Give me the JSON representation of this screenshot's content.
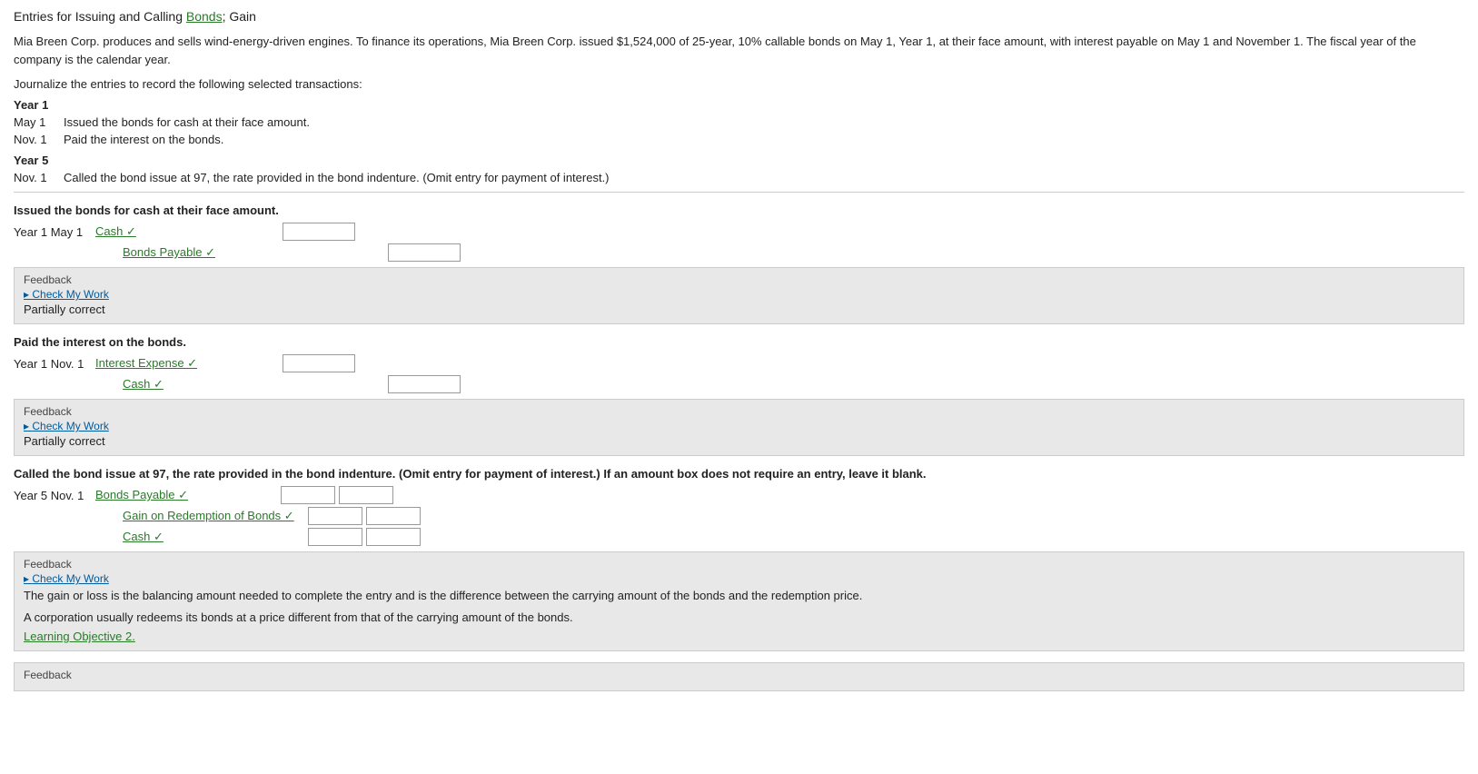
{
  "title": {
    "prefix": "Entries for Issuing and Calling ",
    "link1": "Bonds",
    "middle": "; Gain",
    "description": "Mia Breen Corp. produces and sells wind-energy-driven engines. To finance its operations, Mia Breen Corp. issued $1,524,000 of 25-year, 10% callable bonds on May 1, Year 1, at their face amount, with interest payable on May 1 and November 1. The fiscal year of the company is the calendar year."
  },
  "instruction": "Journalize the entries to record the following selected transactions:",
  "year1_label": "Year 1",
  "year5_label": "Year 5",
  "transactions": [
    {
      "date": "May 1",
      "text": "Issued the bonds for cash at their face amount."
    },
    {
      "date": "Nov. 1",
      "text": "Paid the interest on the bonds."
    },
    {
      "date": "Nov. 1",
      "text": "Called the bond issue at 97, the rate provided in the bond indenture. (Omit entry for payment of interest.)"
    }
  ],
  "section1": {
    "label": "Issued the bonds for cash at their face amount.",
    "date": "Year 1 May 1",
    "entries": [
      {
        "account": "Cash ✓",
        "indent": false
      },
      {
        "account": "Bonds Payable ✓",
        "indent": true
      }
    ]
  },
  "section2": {
    "label": "Paid the interest on the bonds.",
    "date": "Year 1 Nov. 1",
    "entries": [
      {
        "account": "Interest Expense ✓",
        "indent": false
      },
      {
        "account": "Cash ✓",
        "indent": true
      }
    ]
  },
  "section3": {
    "label": "Called the bond issue at 97, the rate provided in the bond indenture. (Omit entry for payment of interest.) If an amount box does not require an entry, leave it blank.",
    "date": "Year 5 Nov. 1",
    "entries": [
      {
        "account": "Bonds Payable ✓",
        "indent": false
      },
      {
        "account": "Gain on Redemption of Bonds ✓",
        "indent": true
      },
      {
        "account": "Cash ✓",
        "indent": true
      }
    ]
  },
  "feedback": {
    "label": "Feedback",
    "check_my_work": "Check My Work",
    "partially_correct": "Partially correct",
    "section3_feedback1": "The gain or loss is the balancing amount needed to complete the entry and is the difference between the carrying amount of the bonds and the redemption price.",
    "section3_feedback2": "A corporation usually redeems its bonds at a price different from that of the carrying amount of the bonds.",
    "learning_link": "Learning Objective 2.",
    "section4_label": "Feedback"
  }
}
